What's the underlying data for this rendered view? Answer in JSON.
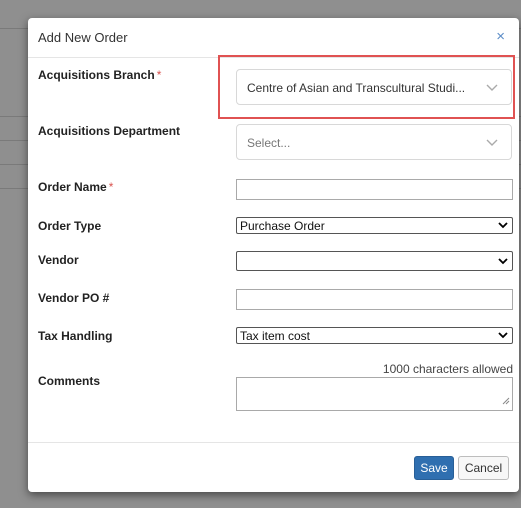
{
  "dialog": {
    "title": "Add New Order",
    "close_glyph": "×",
    "required_marker": "*"
  },
  "fields": {
    "acquisitions_branch": {
      "label": "Acquisitions Branch",
      "value": "Centre of Asian and Transcultural Studi..."
    },
    "acquisitions_department": {
      "label": "Acquisitions Department",
      "placeholder": "Select..."
    },
    "order_name": {
      "label": "Order Name",
      "value": ""
    },
    "order_type": {
      "label": "Order Type",
      "value": "Purchase Order"
    },
    "vendor": {
      "label": "Vendor",
      "value": ""
    },
    "vendor_po": {
      "label": "Vendor PO #",
      "value": ""
    },
    "tax_handling": {
      "label": "Tax Handling",
      "value": "Tax item cost"
    },
    "comments": {
      "label": "Comments",
      "char_limit_text": "1000 characters allowed",
      "value": ""
    }
  },
  "footer": {
    "save_label": "Save",
    "cancel_label": "Cancel"
  },
  "colors": {
    "primary_button": "#2f6fb0",
    "highlight_border": "#e05252",
    "required": "#d9534f"
  }
}
